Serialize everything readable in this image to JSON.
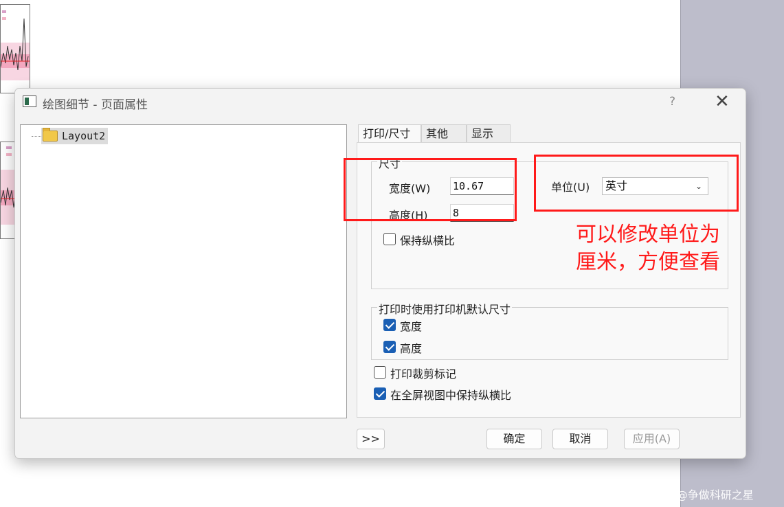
{
  "dialog": {
    "title": "绘图细节 - 页面属性",
    "help": "?",
    "close": "✕"
  },
  "tree": {
    "items": [
      {
        "label": "Layout2"
      }
    ]
  },
  "tabs": [
    {
      "label": "打印/尺寸",
      "active": true
    },
    {
      "label": "其他",
      "active": false
    },
    {
      "label": "显示",
      "active": false
    }
  ],
  "size_group": {
    "title": "尺寸",
    "width_label": "宽度(W)",
    "width_value": "10.67",
    "height_label": "高度(H)",
    "height_value": "8",
    "unit_label": "单位(U)",
    "unit_value": "英寸",
    "keep_ratio": {
      "label": "保持纵横比",
      "checked": false
    }
  },
  "printer_group": {
    "title": "打印时使用打印机默认尺寸",
    "width": {
      "label": "宽度",
      "checked": true
    },
    "height": {
      "label": "高度",
      "checked": true
    }
  },
  "options": {
    "crop_marks": {
      "label": "打印裁剪标记",
      "checked": false
    },
    "fullscreen_ratio": {
      "label": "在全屏视图中保持纵横比",
      "checked": true
    }
  },
  "buttons": {
    "expand": ">>",
    "ok": "确定",
    "cancel": "取消",
    "apply": "应用(A)"
  },
  "annotation": {
    "line1": "可以修改单位为",
    "line2": "厘米，方便查看",
    "color": "#ff1a1a"
  },
  "watermark": "CSDN @争做科研之星",
  "colors": {
    "checkbox_accent": "#1a5fb4",
    "dialog_bg": "#f3f3f3"
  }
}
